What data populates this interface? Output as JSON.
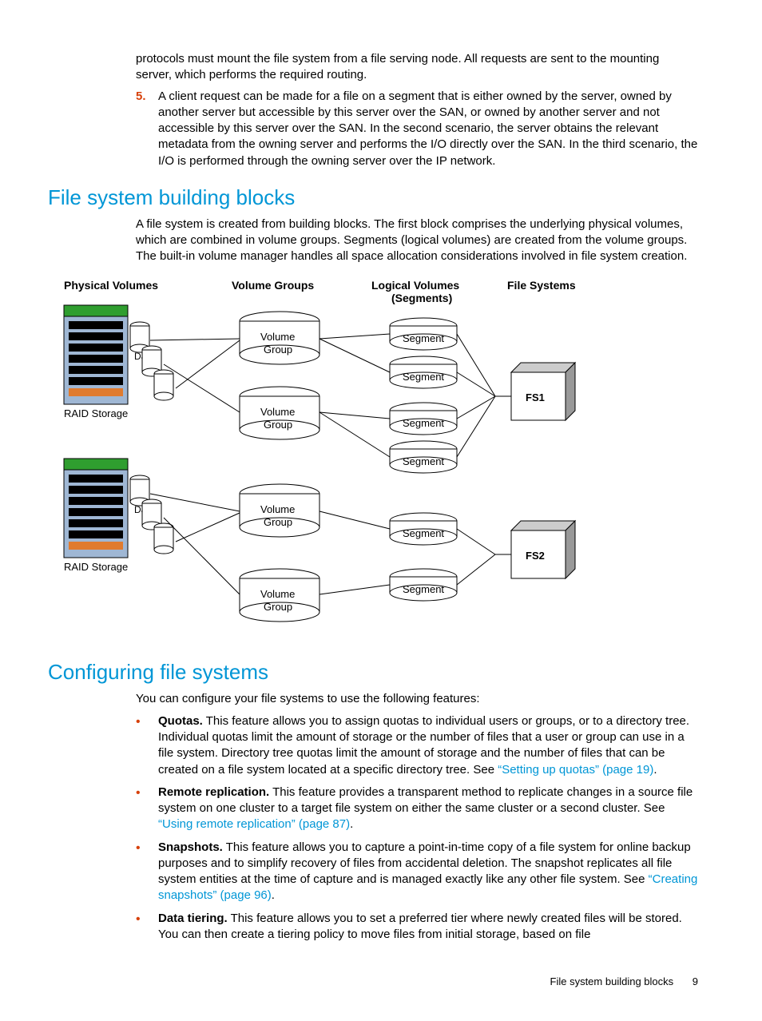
{
  "top": {
    "para1": "protocols must mount the file system from a file serving node. All requests are sent to the mounting server, which performs the required routing.",
    "num5": "5.",
    "para2": "A client request can be made for a file on a segment that is either owned by the server, owned by another server but accessible by this server over the SAN, or owned by another server and not accessible by this server over the SAN. In the second scenario, the server obtains the relevant metadata from the owning server and performs the I/O directly over the SAN. In the third scenario, the I/O is performed through the owning server over the IP network."
  },
  "h_fsbb": "File system building blocks",
  "fsbb_para": "A file system is created from building blocks. The first block comprises the underlying physical volumes, which are combined in volume groups. Segments (logical volumes) are created from the volume groups. The built-in volume manager handles all space allocation considerations involved in file system creation.",
  "diagram": {
    "cols": {
      "pv": "Physical Volumes",
      "vg": "Volume Groups",
      "lv1": "Logical Volumes",
      "lv2": "(Segments)",
      "fs": "File Systems"
    },
    "raid": "RAID Storage",
    "data": "Data",
    "vgroup1": "Volume",
    "vgroup2": "Group",
    "segment": "Segment",
    "fs1": "FS1",
    "fs2": "FS2"
  },
  "h_cfg": "Configuring file systems",
  "cfg_intro": "You can configure your file systems to use the following features:",
  "features": {
    "quotas": {
      "b": "Quotas.",
      "t": " This feature allows you to assign quotas to individual users or groups, or to a directory tree. Individual quotas limit the amount of storage or the number of files that a user or group can use in a file system. Directory tree quotas limit the amount of storage and the number of files that can be created on a file system located at a specific directory tree. See ",
      "link": "“Setting up quotas” (page 19)",
      "after": "."
    },
    "remote": {
      "b": "Remote replication.",
      "t": " This feature provides a transparent method to replicate changes in a source file system on one cluster to a target file system on either the same cluster or a second cluster. See ",
      "link": "“Using remote replication” (page 87)",
      "after": "."
    },
    "snap": {
      "b": "Snapshots.",
      "t": " This feature allows you to capture a point-in-time copy of a file system for online backup purposes and to simplify recovery of files from accidental deletion. The snapshot replicates all file system entities at the time of capture and is managed exactly like any other file system. See ",
      "link": "“Creating snapshots” (page 96)",
      "after": "."
    },
    "tier": {
      "b": "Data tiering.",
      "t": " This feature allows you to set a preferred tier where newly created files will be stored. You can then create a tiering policy to move files from initial storage, based on file"
    }
  },
  "footer": {
    "title": "File system building blocks",
    "page": "9"
  }
}
